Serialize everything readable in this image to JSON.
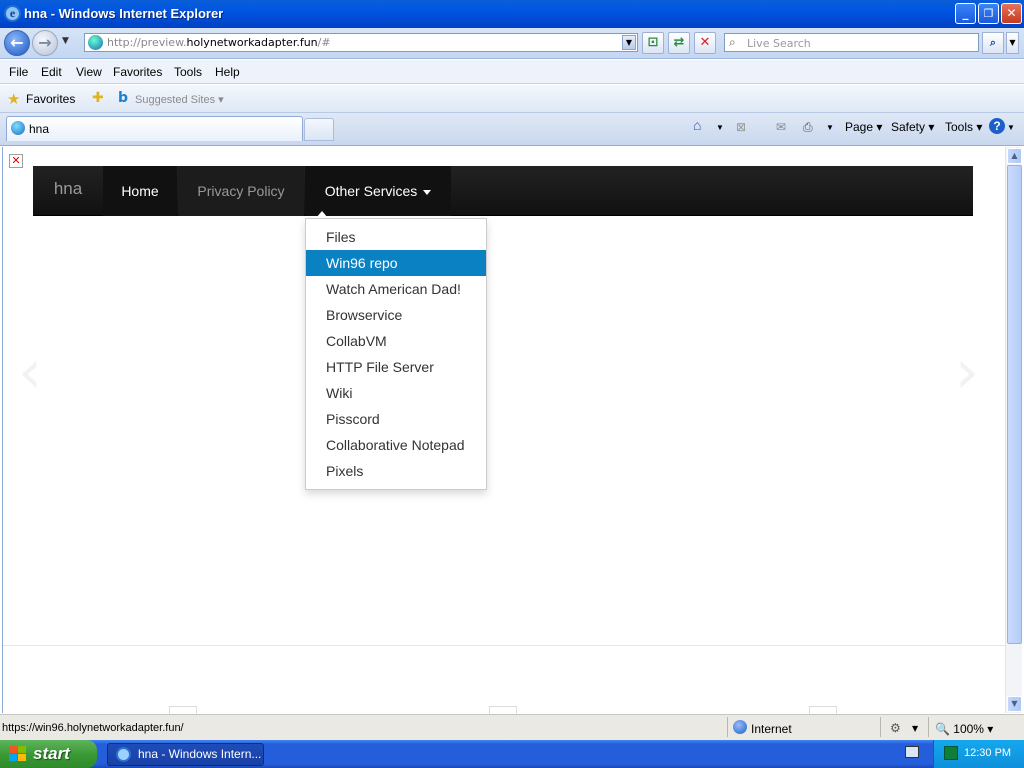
{
  "window": {
    "title": "hna - Windows Internet Explorer",
    "min_glyph": "_",
    "max_glyph": "❐",
    "close_glyph": "✕"
  },
  "addressbar": {
    "url_prefix": "http://preview.",
    "url_domain": "holynetworkadapter.fun",
    "url_suffix": "/#",
    "search_placeholder": "Live Search"
  },
  "menu": [
    "File",
    "Edit",
    "View",
    "Favorites",
    "Tools",
    "Help"
  ],
  "favorites_bar": {
    "favorites_label": "Favorites",
    "suggested_label": "Suggested Sites ▾"
  },
  "tab": {
    "title": "hna"
  },
  "command_bar": {
    "page": "Page ▾",
    "safety": "Safety ▾",
    "tools": "Tools ▾"
  },
  "site": {
    "brand": "hna",
    "nav": {
      "home": "Home",
      "privacy": "Privacy Policy",
      "other": "Other Services"
    },
    "dropdown": [
      {
        "label": "Files",
        "active": false
      },
      {
        "label": "Win96 repo",
        "active": true
      },
      {
        "label": "Watch American Dad!",
        "active": false
      },
      {
        "label": "Browservice",
        "active": false
      },
      {
        "label": "CollabVM",
        "active": false
      },
      {
        "label": "HTTP File Server",
        "active": false
      },
      {
        "label": "Wiki",
        "active": false
      },
      {
        "label": "Pisscord",
        "active": false
      },
      {
        "label": "Collaborative Notepad",
        "active": false
      },
      {
        "label": "Pixels",
        "active": false
      }
    ],
    "carousel_prev": "‹",
    "carousel_next": "›"
  },
  "statusbar": {
    "text": "https://win96.holynetworkadapter.fun/",
    "zone": "Internet",
    "zoom": "🔍 100%  ▾"
  },
  "taskbar": {
    "start": "start",
    "task": "hna - Windows Intern...",
    "clock": "12:30 PM"
  },
  "colors": {
    "xp_blue": "#0054e3",
    "navbar_bg": "#111111",
    "dropdown_active": "#0a81c2",
    "start_green": "#3a9a35"
  }
}
